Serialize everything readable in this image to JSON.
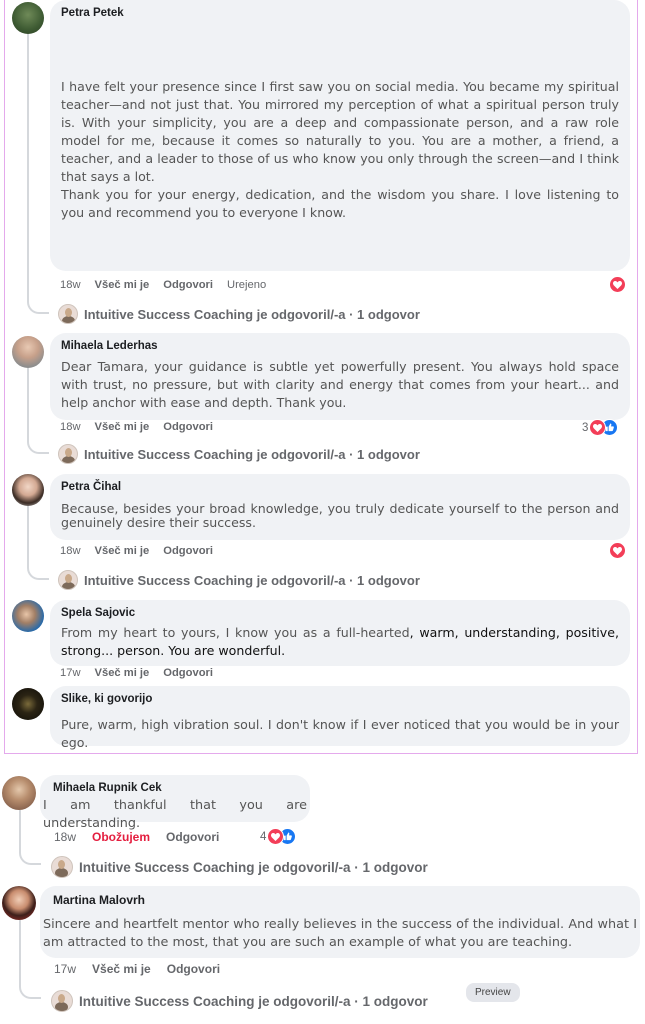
{
  "comments": [
    {
      "author": "Petra Petek",
      "text_1": "I have felt your presence since I first saw you on social media. You became my spiritual teacher—and not just that. You mirrored my perception of what a spiritual person truly is. With your simplicity, you are a deep and compassionate person, and a raw role model for me, because it comes so naturally to you. You are a mother, a friend, a teacher, and a leader to those of us who know you only through the screen—and I think that says a lot.",
      "text_2": "Thank you for your energy, dedication, and the wisdom you share. I love listening to you and recommend you to everyone I know.",
      "time": "18w",
      "like": "Všeč mi je",
      "reply": "Odgovori",
      "edited": "Urejeno",
      "reply_summary": "Intuitive Success Coaching je odgovoril/-a · 1 odgovor"
    },
    {
      "author": "Mihaela Lederhas",
      "text": "Dear Tamara, your guidance is subtle yet powerfully present. You always hold space with trust, no pressure, but with clarity and energy that comes from your heart... and help anchor with ease and depth. Thank you.",
      "time": "18w",
      "like": "Všeč mi je",
      "reply": "Odgovori",
      "reaction_count": "3",
      "reply_summary": "Intuitive Success Coaching je odgovoril/-a · 1 odgovor"
    },
    {
      "author": "Petra Čihal",
      "text": "Because, besides your broad knowledge, you truly dedicate yourself to the person and genuinely desire their success.",
      "time": "18w",
      "like": "Všeč mi je",
      "reply": "Odgovori",
      "reply_summary": "Intuitive Success Coaching je odgovoril/-a · 1 odgovor"
    },
    {
      "author": "Spela Sajovic",
      "text_a": "From my heart to yours, I know you as a full-hearted",
      "text_b": ", warm, understanding, positive, strong... person. You are wonderful.",
      "time": "17w",
      "like": "Všeč mi je",
      "reply": "Odgovori"
    },
    {
      "author": "Slike, ki govorijo",
      "text": "Pure, warm, high vibration soul. I don't know if I ever noticed that you would be in your ego."
    },
    {
      "author": "Mihaela Rupnik Cek",
      "text": "I am thankful that you are understanding.",
      "time": "18w",
      "like": "Obožujem",
      "reply": "Odgovori",
      "reaction_count": "4",
      "reply_summary": "Intuitive Success Coaching je odgovoril/-a · 1 odgovor"
    },
    {
      "author": "Martina Malovrh",
      "text": "Sincere and heartfelt mentor who really believes in the success of the individual. And what I am attracted to the most, that you are such an example of what you are teaching.",
      "time": "17w",
      "like": "Všeč mi je",
      "reply": "Odgovori",
      "reply_summary": "Intuitive Success Coaching je odgovoril/-a · 1 odgovor"
    }
  ],
  "preview_label": "Preview",
  "colors": {
    "love": "#e41e3f",
    "heart": "#f33e58",
    "like": "#1877f2",
    "bubble": "#f0f2f5",
    "frame": "#e4a9ec"
  }
}
